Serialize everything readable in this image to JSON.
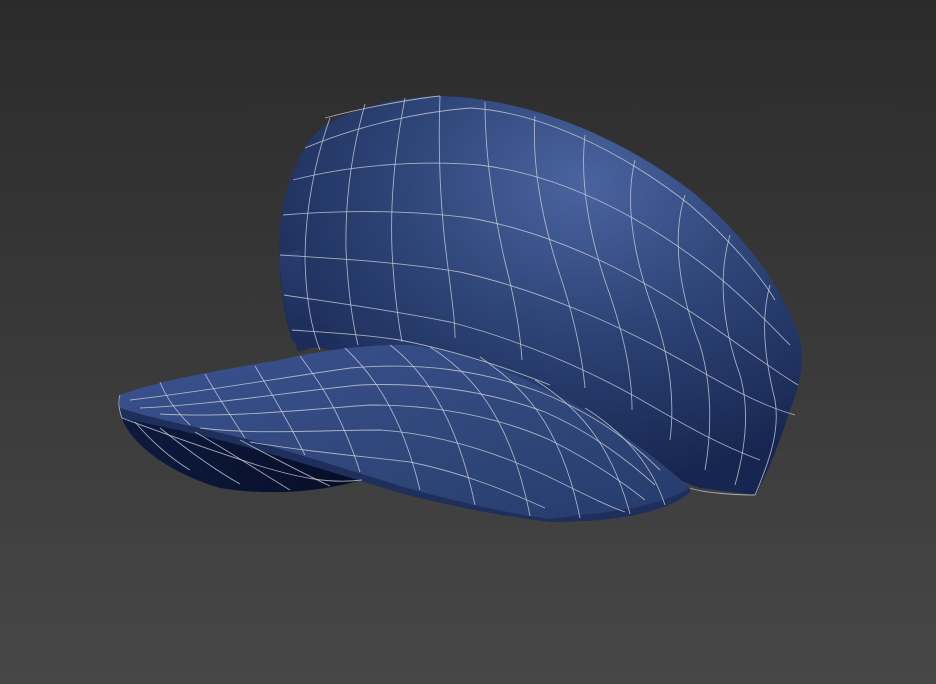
{
  "viewport": {
    "background_top": "#2b2b2b",
    "background_bottom": "#474747"
  },
  "model": {
    "object": "cap",
    "material_color": "#2e4376",
    "material_shadow_color": "#0c1634",
    "material_highlight_color": "#4a64a0",
    "wireframe_color": "#c8ccd6",
    "shading": "smooth-with-wireframe-overlay"
  }
}
